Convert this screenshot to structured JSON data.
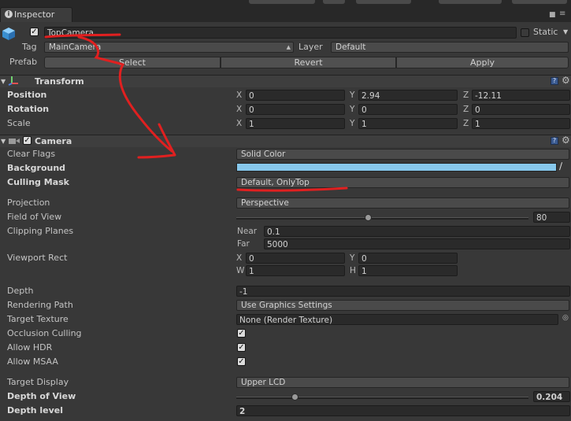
{
  "tab": {
    "title": "Inspector"
  },
  "object": {
    "name": "TopCamera",
    "static_label": "Static",
    "tag_label": "Tag",
    "tag_value": "MainCamera",
    "layer_label": "Layer",
    "layer_value": "Default",
    "prefab_label": "Prefab",
    "select_label": "Select",
    "revert_label": "Revert",
    "apply_label": "Apply"
  },
  "transform": {
    "title": "Transform",
    "position_label": "Position",
    "rotation_label": "Rotation",
    "scale_label": "Scale",
    "axis_x": "X",
    "axis_y": "Y",
    "axis_z": "Z",
    "position": {
      "x": "0",
      "y": "2.94",
      "z": "-12.11"
    },
    "rotation": {
      "x": "0",
      "y": "0",
      "z": "0"
    },
    "scale": {
      "x": "1",
      "y": "1",
      "z": "1"
    }
  },
  "camera": {
    "title": "Camera",
    "clear_flags_label": "Clear Flags",
    "clear_flags_value": "Solid Color",
    "background_label": "Background",
    "background_color": "#87c8ec",
    "culling_mask_label": "Culling Mask",
    "culling_mask_value": "Default, OnlyTop",
    "projection_label": "Projection",
    "projection_value": "Perspective",
    "fov_label": "Field of View",
    "fov_value": "80",
    "fov_fraction": 0.45,
    "clipping_label": "Clipping Planes",
    "near_label": "Near",
    "near_value": "0.1",
    "far_label": "Far",
    "far_value": "5000",
    "viewport_label": "Viewport Rect",
    "vp_x_label": "X",
    "vp_x": "0",
    "vp_y_label": "Y",
    "vp_y": "0",
    "vp_w_label": "W",
    "vp_w": "1",
    "vp_h_label": "H",
    "vp_h": "1",
    "depth_label": "Depth",
    "depth_value": "-1",
    "rendering_path_label": "Rendering Path",
    "rendering_path_value": "Use Graphics Settings",
    "target_texture_label": "Target Texture",
    "target_texture_value": "None (Render Texture)",
    "occlusion_label": "Occlusion Culling",
    "hdr_label": "Allow HDR",
    "msaa_label": "Allow MSAA",
    "target_display_label": "Target Display",
    "target_display_value": "Upper LCD",
    "depth_of_view_label": "Depth of View",
    "depth_of_view_value": "0.204",
    "depth_of_view_fraction": 0.2,
    "depth_level_label": "Depth level",
    "depth_level_value": "2"
  },
  "colors": {
    "annotation": "#e02020",
    "panel": "#383838"
  }
}
